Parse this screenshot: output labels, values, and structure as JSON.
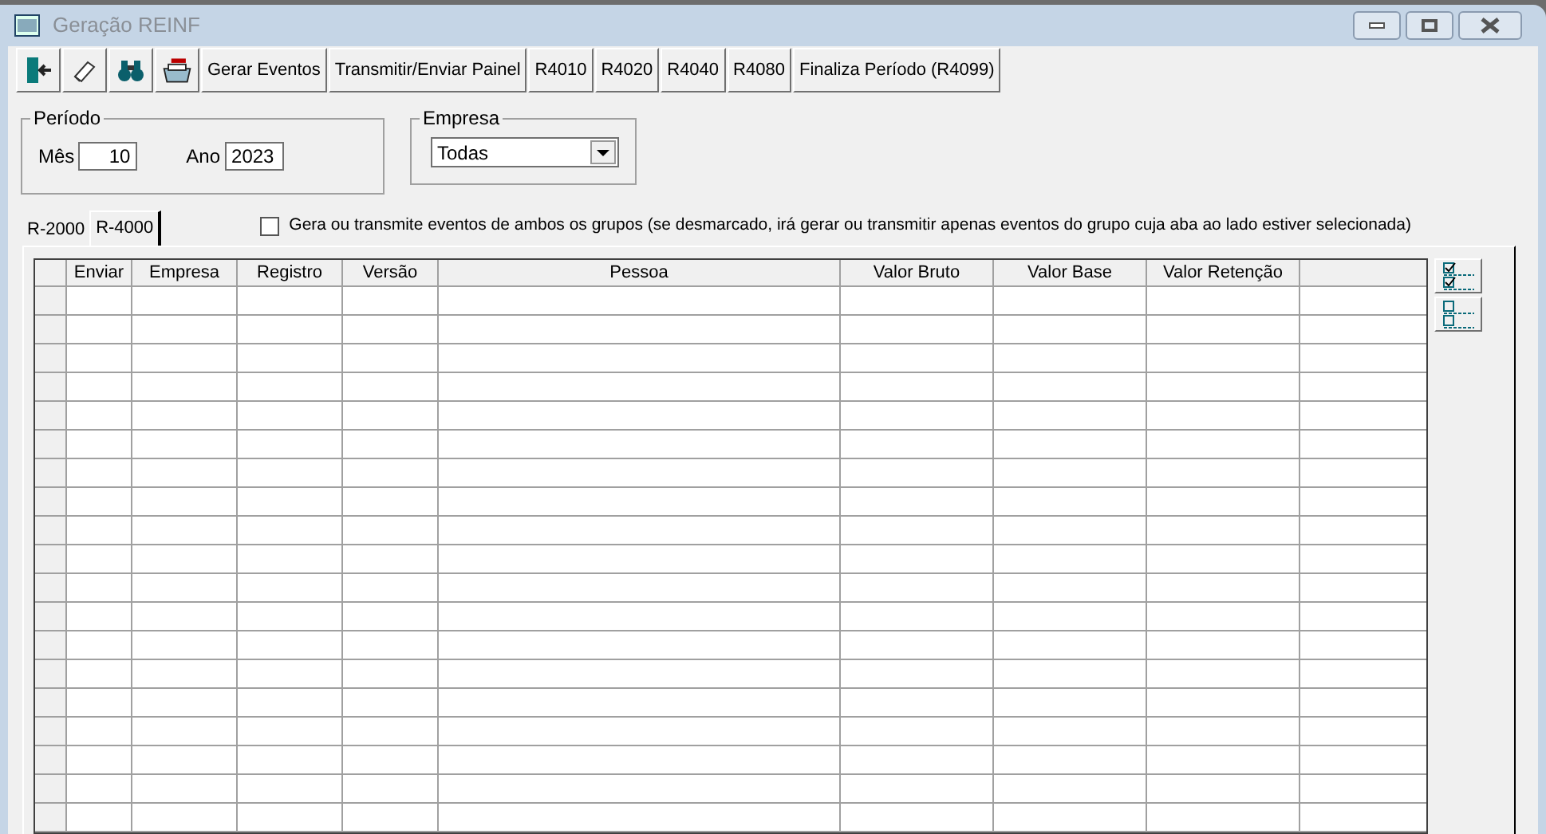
{
  "window": {
    "title": "Geração REINF"
  },
  "toolbar": {
    "icon_buttons": [
      {
        "kind": "exit"
      },
      {
        "kind": "eraser"
      },
      {
        "kind": "binoculars"
      },
      {
        "kind": "printer"
      }
    ],
    "buttons": [
      "Gerar Eventos",
      "Transmitir/Enviar Painel",
      "R4010",
      "R4020",
      "R4040",
      "R4080",
      "Finaliza Período (R4099)"
    ]
  },
  "periodo": {
    "label": "Período",
    "mes_label": "Mês",
    "mes": "10",
    "ano_label": "Ano",
    "ano": "2023"
  },
  "empresa": {
    "label": "Empresa",
    "value": "Todas"
  },
  "tabs": [
    {
      "label": "R-2000",
      "selected": false
    },
    {
      "label": "R-4000",
      "selected": true
    }
  ],
  "both_groups": {
    "label": "Gera ou transmite eventos de ambos os grupos (se desmarcado, irá gerar ou transmitir apenas eventos do grupo cuja aba ao lado estiver selecionada)",
    "checked": false
  },
  "table": {
    "columns": [
      "Enviar",
      "Empresa",
      "Registro",
      "Versão",
      "Pessoa",
      "Valor Bruto",
      "Valor Base",
      "Valor Retenção"
    ]
  }
}
